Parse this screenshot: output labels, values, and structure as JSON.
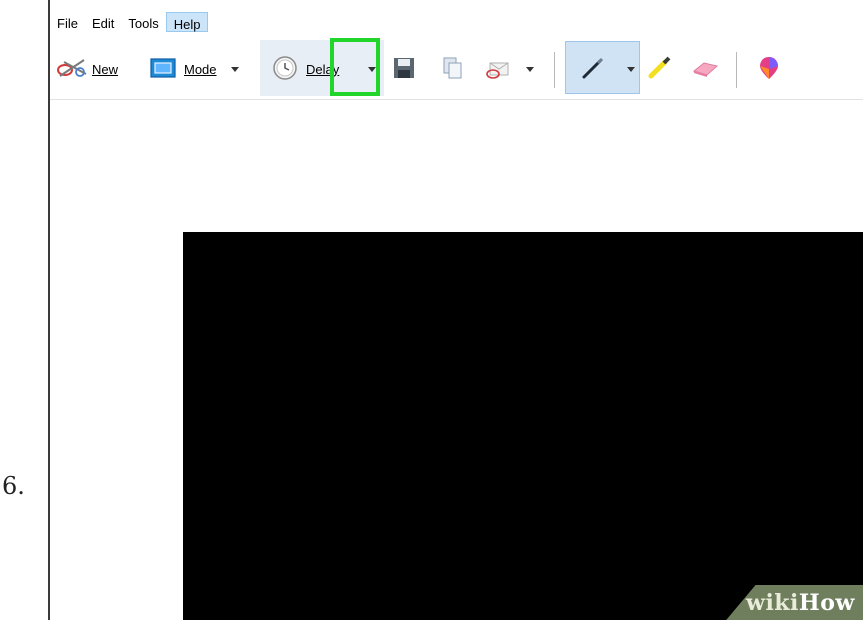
{
  "step": {
    "number": "6."
  },
  "menu": {
    "items": [
      {
        "label": "File"
      },
      {
        "label": "Edit"
      },
      {
        "label": "Tools"
      },
      {
        "label": "Help"
      }
    ]
  },
  "toolbar": {
    "new_label": "New",
    "mode_label": "Mode",
    "delay_label": "Delay",
    "icons": {
      "new": "scissors-icon",
      "mode": "rectangle-mode-icon",
      "delay": "clock-icon",
      "save": "save-icon",
      "copy": "copy-icon",
      "send": "envelope-icon",
      "pen": "pen-icon",
      "highlighter": "highlighter-icon",
      "eraser": "eraser-icon",
      "paint3d": "paint3d-icon"
    }
  },
  "highlight_color": "#22d52b",
  "watermark": {
    "part1": "wiki",
    "part2": "How"
  }
}
